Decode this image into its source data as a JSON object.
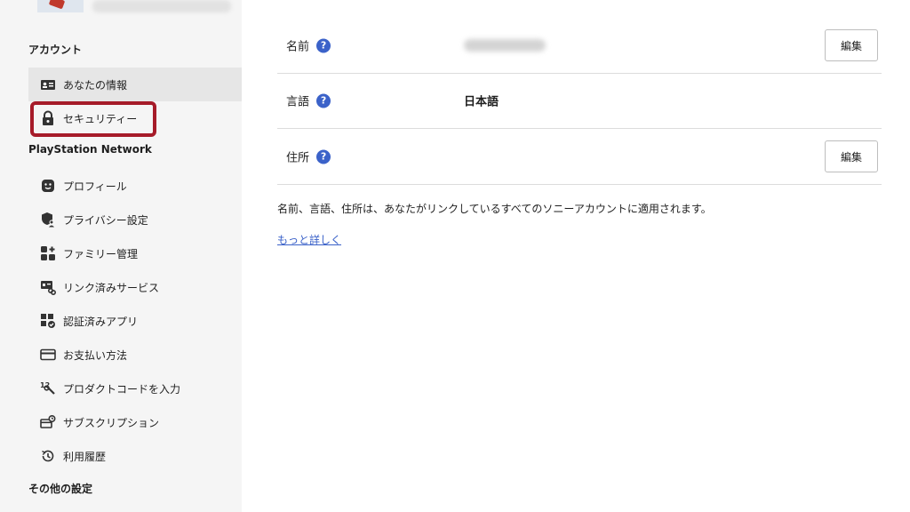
{
  "sidebar": {
    "sections": {
      "account": "アカウント",
      "psn": "PlayStation Network",
      "other": "その他の設定"
    },
    "items": [
      {
        "label": "あなたの情報",
        "icon": "id-card-icon"
      },
      {
        "label": "セキュリティー",
        "icon": "lock-icon"
      },
      {
        "label": "プロフィール",
        "icon": "face-icon"
      },
      {
        "label": "プライバシー設定",
        "icon": "privacy-shield-icon"
      },
      {
        "label": "ファミリー管理",
        "icon": "family-icon"
      },
      {
        "label": "リンク済みサービス",
        "icon": "linked-services-icon"
      },
      {
        "label": "認証済みアプリ",
        "icon": "authorized-apps-icon"
      },
      {
        "label": "お支払い方法",
        "icon": "credit-card-icon"
      },
      {
        "label": "プロダクトコードを入力",
        "icon": "product-code-icon"
      },
      {
        "label": "サブスクリプション",
        "icon": "subscription-icon"
      },
      {
        "label": "利用履歴",
        "icon": "history-icon"
      }
    ]
  },
  "main": {
    "rows": [
      {
        "label": "名前",
        "value": "",
        "edit": "編集"
      },
      {
        "label": "言語",
        "value": "日本語"
      },
      {
        "label": "住所",
        "value": "",
        "edit": "編集"
      }
    ],
    "help_glyph": "?",
    "note": "名前、言語、住所は、あなたがリンクしているすべてのソニーアカウントに適用されます。",
    "more_link": "もっと詳しく"
  },
  "colors": {
    "highlight": "#a61b29",
    "link": "#3b62c9",
    "sidebar_bg": "#f5f5f5",
    "active_bg": "#e6e6e6"
  }
}
